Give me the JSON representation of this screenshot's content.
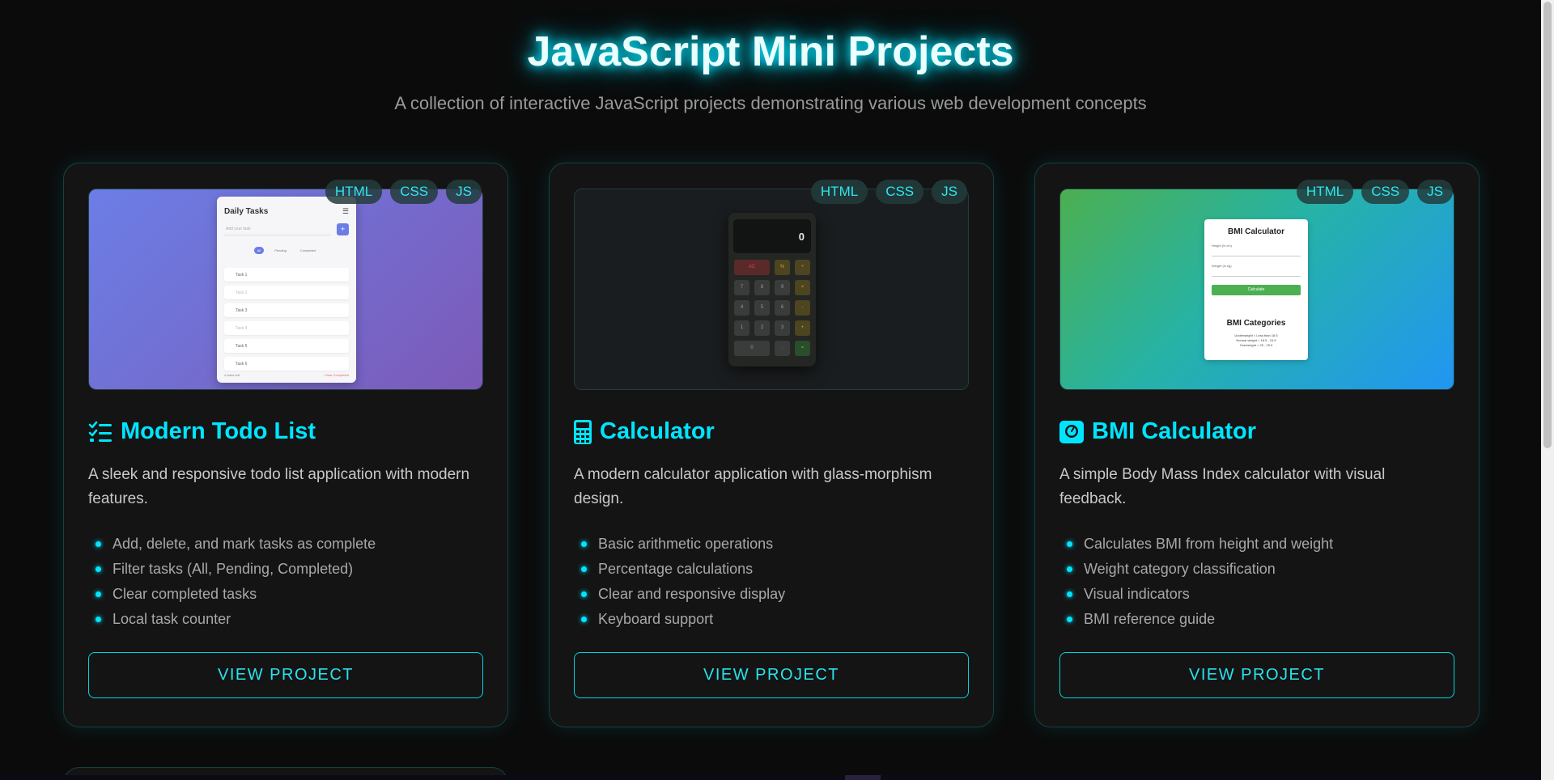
{
  "header": {
    "title": "JavaScript Mini Projects",
    "subtitle": "A collection of interactive JavaScript projects demonstrating various web development concepts"
  },
  "projects": [
    {
      "title": "Modern Todo List",
      "icon": "list-check-icon",
      "tags": [
        "HTML",
        "CSS",
        "JS"
      ],
      "description": "A sleek and responsive todo list application with modern features.",
      "features": [
        "Add, delete, and mark tasks as complete",
        "Filter tasks (All, Pending, Completed)",
        "Clear completed tasks",
        "Local task counter"
      ],
      "button": "VIEW PROJECT",
      "preview": {
        "heading": "Daily Tasks",
        "input_placeholder": "Add your task",
        "add": "+",
        "filters": [
          "All",
          "Pending",
          "Completed"
        ],
        "items": [
          "Task 1",
          "Task 2",
          "Task 3",
          "Task 4",
          "Task 5",
          "Task 6"
        ],
        "footer_left": "4 tasks left",
        "footer_right": "Clear Completed"
      }
    },
    {
      "title": "Calculator",
      "icon": "calculator-icon",
      "tags": [
        "HTML",
        "CSS",
        "JS"
      ],
      "description": "A modern calculator application with glass-morphism design.",
      "features": [
        "Basic arithmetic operations",
        "Percentage calculations",
        "Clear and responsive display",
        "Keyboard support"
      ],
      "button": "VIEW PROJECT",
      "preview": {
        "display": "0",
        "keys": [
          "AC",
          "%",
          "÷",
          "7",
          "8",
          "9",
          "×",
          "4",
          "5",
          "6",
          "-",
          "1",
          "2",
          "3",
          "+",
          "0",
          ".",
          "="
        ]
      }
    },
    {
      "title": "BMI Calculator",
      "icon": "weight-scale-icon",
      "tags": [
        "HTML",
        "CSS",
        "JS"
      ],
      "description": "A simple Body Mass Index calculator with visual feedback.",
      "features": [
        "Calculates BMI from height and weight",
        "Weight category classification",
        "Visual indicators",
        "BMI reference guide"
      ],
      "button": "VIEW PROJECT",
      "preview": {
        "heading": "BMI Calculator",
        "height_label": "Height (in cm)",
        "weight_label": "Weight (in kg)",
        "button": "Calculate",
        "categories_heading": "BMI Categories",
        "categories": [
          "Underweight = Less than 18.5",
          "Normal weight = 18.5 - 24.9",
          "Overweight = 25 - 29.9"
        ]
      }
    }
  ],
  "colors": {
    "accent": "#00e5ff",
    "background": "#0b0b0b",
    "card": "#141414"
  }
}
